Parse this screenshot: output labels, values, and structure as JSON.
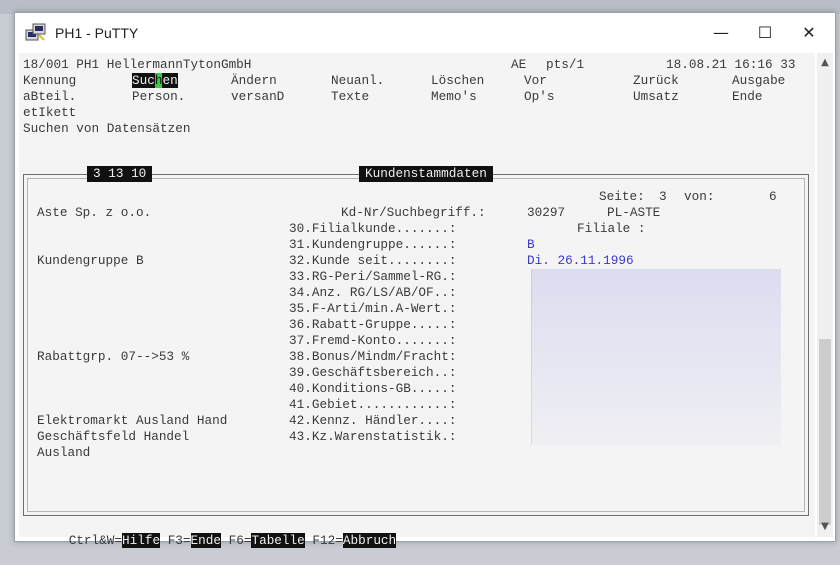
{
  "window": {
    "title": "PH1 - PuTTY",
    "controls": {
      "minimize": "—",
      "maximize": "☐",
      "close": "✕"
    }
  },
  "status": {
    "left": "18/001 PH1 HellermannTytonGmbH",
    "code": "AE",
    "terminal": "pts/1",
    "datetime": "18.08.21 16:16 33"
  },
  "menu": {
    "row1": [
      {
        "pre": "Kennung"
      },
      {
        "pre": "Suc",
        "cursor": "h",
        "post": "en"
      },
      {
        "pre": "Ändern"
      },
      {
        "pre": "Neuanl."
      },
      {
        "pre": "Löschen"
      },
      {
        "pre": "Vor"
      },
      {
        "pre": "Zurück"
      },
      {
        "pre": "Ausgabe"
      }
    ],
    "row2": [
      "aBteil.",
      "Person.",
      "versanD",
      "Texte",
      "Memo's",
      "Op's",
      "Umsatz",
      "Ende"
    ],
    "row3": [
      "etIkett"
    ]
  },
  "mode_text": "Suchen von Datensätzen",
  "record_code": "3 13 10",
  "section_title": "Kundenstammdaten",
  "page": {
    "label": "Seite:",
    "current": "3",
    "of_label": "von:",
    "total": "6"
  },
  "customer": {
    "name": "Aste Sp. z o.o.",
    "kdnr_label": "Kd-Nr/Suchbegriff.:",
    "kdnr": "30297",
    "suchbegriff": "PL-ASTE",
    "filiale_label": "Filiale :"
  },
  "left_column": {
    "kundengruppe": "Kundengruppe B",
    "rabattgrp": "Rabattgrp. 07-->53 %",
    "gb1": "Elektromarkt Ausland Hand",
    "gb2": "Geschäftsfeld Handel",
    "gb3": "Ausland"
  },
  "fields": [
    {
      "label": "30.Filialkunde.......:",
      "value": ""
    },
    {
      "label": "31.Kundengruppe......:",
      "value": "B"
    },
    {
      "label": "32.Kunde seit........:",
      "value": "Di. 26.11.1996"
    },
    {
      "label": "33.RG-Peri/Sammel-RG.:",
      "value": ""
    },
    {
      "label": "34.Anz. RG/LS/AB/OF..:",
      "value": ""
    },
    {
      "label": "35.F-Arti/min.A-Wert.:",
      "value": ""
    },
    {
      "label": "36.Rabatt-Gruppe.....:",
      "value": ""
    },
    {
      "label": "37.Fremd-Konto.......:",
      "value": ""
    },
    {
      "label": "38.Bonus/Mindm/Fracht:",
      "value": ""
    },
    {
      "label": "39.Geschäftsbereich..:",
      "value": ""
    },
    {
      "label": "40.Konditions-GB.....:",
      "value": ""
    },
    {
      "label": "41.Gebiet............:",
      "value": ""
    },
    {
      "label": "42.Kennz. Händler....:",
      "value": ""
    },
    {
      "label": "43.Kz.Warenstatistik.:",
      "value": ""
    }
  ],
  "fkeys": [
    {
      "key": "Ctrl&W=",
      "action": "Hilfe"
    },
    {
      "key": "F3=",
      "action": "Ende"
    },
    {
      "key": "F6=",
      "action": "Tabelle"
    },
    {
      "key": "F12=",
      "action": "Abbruch"
    }
  ],
  "colors": {
    "value_blue": "#3a3ad0",
    "cursor_green": "#36d03a",
    "inverse_bg": "#111111"
  },
  "icons": {
    "app": "putty-icon",
    "scroll_up": "chevron-up-icon",
    "scroll_down": "chevron-down-icon"
  }
}
